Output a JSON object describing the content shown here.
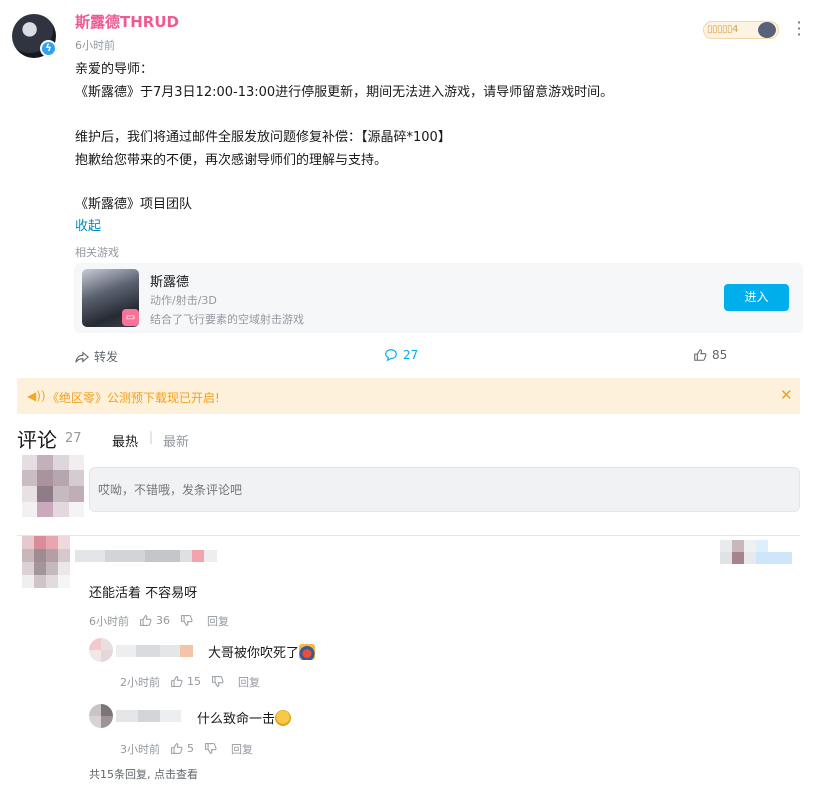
{
  "post": {
    "author": "斯露德THRUD",
    "time": "6小时前",
    "medal_text": "▯▯▯▯▯4",
    "lines": [
      "亲爱的导师：",
      "《斯露德》于7月3日12:00-13:00进行停服更新，期间无法进入游戏，请导师留意游戏时间。",
      "",
      "维护后，我们将通过邮件全服发放问题修复补偿：【源晶碎*100】",
      "抱歉给您带来的不便，再次感谢导师们的理解与支持。",
      "",
      "《斯露德》项目团队"
    ],
    "fold_label": "收起",
    "related_label": "相关游戏"
  },
  "game": {
    "name": "斯露德",
    "tags": "动作/射击/3D",
    "desc": "结合了飞行要素的空域射击游戏",
    "enter_label": "进入"
  },
  "actions": {
    "forward_label": "转发",
    "comment_count": "27",
    "like_count": "85"
  },
  "notice": {
    "text": "《绝区零》公测预下载现已开启!"
  },
  "comments": {
    "title": "评论",
    "count": "27",
    "sort_hot": "最热",
    "sort_new": "最新",
    "input_placeholder": "哎呦，不错哦，发条评论吧",
    "items": [
      {
        "text": "还能活着 不容易呀",
        "time": "6小时前",
        "likes": "36",
        "reply_label": "回复",
        "replies": [
          {
            "text": "大哥被你吹死了",
            "time": "2小时前",
            "likes": "15",
            "reply_label": "回复"
          },
          {
            "text": "什么致命一击",
            "time": "3小时前",
            "likes": "5",
            "reply_label": "回复"
          }
        ],
        "more_replies": "共15条回复, 点击查看"
      }
    ]
  },
  "colors": {
    "author_pink": "#ee5a94",
    "link_blue": "#008ac5",
    "button_blue": "#00aeec",
    "notice_bg": "#fdf1dc",
    "notice_text": "#f0a020"
  }
}
